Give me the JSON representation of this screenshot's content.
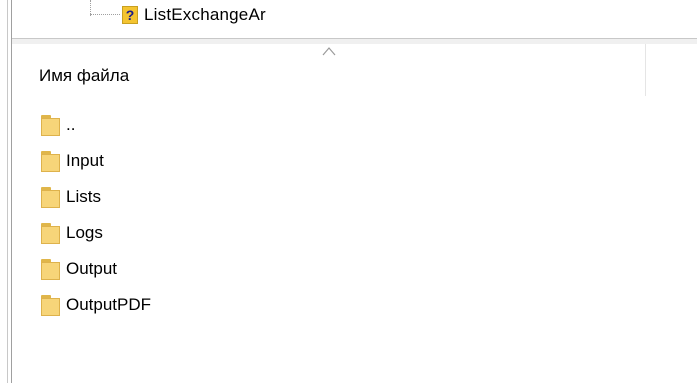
{
  "tree": {
    "item_label": "ListExchangeAr",
    "item_icon": "question-folder-icon"
  },
  "file_list": {
    "column_header": "Имя файла",
    "sort_indicator": "sort-ascending-icon",
    "items": [
      {
        "name": "..",
        "icon": "folder-icon"
      },
      {
        "name": "Input",
        "icon": "folder-icon"
      },
      {
        "name": "Lists",
        "icon": "folder-icon"
      },
      {
        "name": "Logs",
        "icon": "folder-icon"
      },
      {
        "name": "Output",
        "icon": "folder-icon"
      },
      {
        "name": "OutputPDF",
        "icon": "folder-icon"
      }
    ]
  },
  "colors": {
    "folder_fill": "#f7d579",
    "folder_border": "#deb24c",
    "question_icon": "#f4c430"
  }
}
